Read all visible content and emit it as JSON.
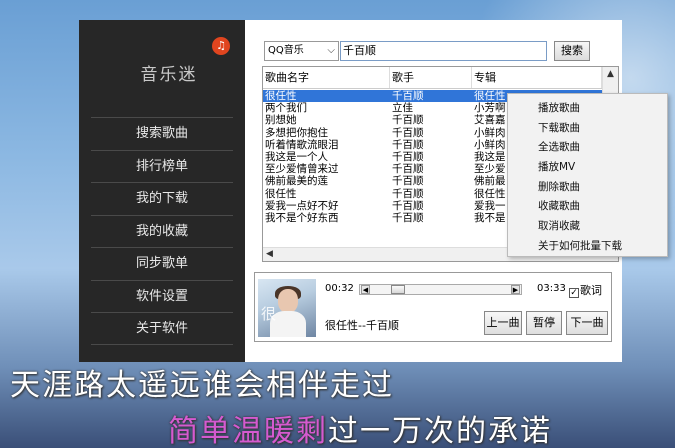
{
  "app": {
    "title": "音乐迷",
    "logo_glyph": "♫",
    "accent_color": "#e0451f",
    "sidebar_bg": "#272727"
  },
  "sidebar": {
    "items": [
      {
        "label": "搜索歌曲"
      },
      {
        "label": "排行榜单"
      },
      {
        "label": "我的下载"
      },
      {
        "label": "我的收藏"
      },
      {
        "label": "同步歌单"
      },
      {
        "label": "软件设置"
      },
      {
        "label": "关于软件"
      }
    ]
  },
  "search": {
    "source": "QQ音乐",
    "query": "千百顺",
    "button": "搜索"
  },
  "list": {
    "columns": [
      "歌曲名字",
      "歌手",
      "专辑"
    ],
    "selected_color": "#3075d8",
    "rows": [
      {
        "name": "很任性",
        "singer": "千百顺",
        "album": "很任性",
        "selected": true
      },
      {
        "name": "两个我们",
        "singer": "立佳",
        "album": "小芳啊"
      },
      {
        "name": "别想她",
        "singer": "千百顺",
        "album": "艾喜嘉"
      },
      {
        "name": "多想把你抱住",
        "singer": "千百顺",
        "album": "小鲜肉"
      },
      {
        "name": "听着情歌流眼泪",
        "singer": "千百顺",
        "album": "小鲜肉"
      },
      {
        "name": "我这是一个人",
        "singer": "千百顺",
        "album": "我这是"
      },
      {
        "name": "至少爱情曾来过",
        "singer": "千百顺",
        "album": "至少爱"
      },
      {
        "name": "佛前最美的莲",
        "singer": "千百顺",
        "album": "佛前最"
      },
      {
        "name": "很任性",
        "singer": "千百顺",
        "album": "很任性"
      },
      {
        "name": "爱我一点好不好",
        "singer": "千百顺",
        "album": "爱我一"
      },
      {
        "name": "我不是个好东西",
        "singer": "千百顺",
        "album": "我不是"
      }
    ]
  },
  "player": {
    "current_time": "00:32",
    "total_time": "03:33",
    "progress": 0.15,
    "lyrics_label": "歌词",
    "lyrics_checked": true,
    "now_playing": "很任性--千百顺",
    "cover_mark": "很",
    "prev": "上一曲",
    "pause": "暂停",
    "next": "下一曲"
  },
  "context_menu": {
    "items": [
      "播放歌曲",
      "下载歌曲",
      "全选歌曲",
      "播放MV",
      "删除歌曲",
      "收藏歌曲",
      "取消收藏",
      "关于如何批量下载"
    ]
  },
  "lyrics_overlay": {
    "line1": "天涯路太遥远谁会相伴走过",
    "line2_highlight": "简单温暖剩",
    "line2_rest": "过一万次的承诺",
    "highlight_color": "#d55ad0"
  }
}
